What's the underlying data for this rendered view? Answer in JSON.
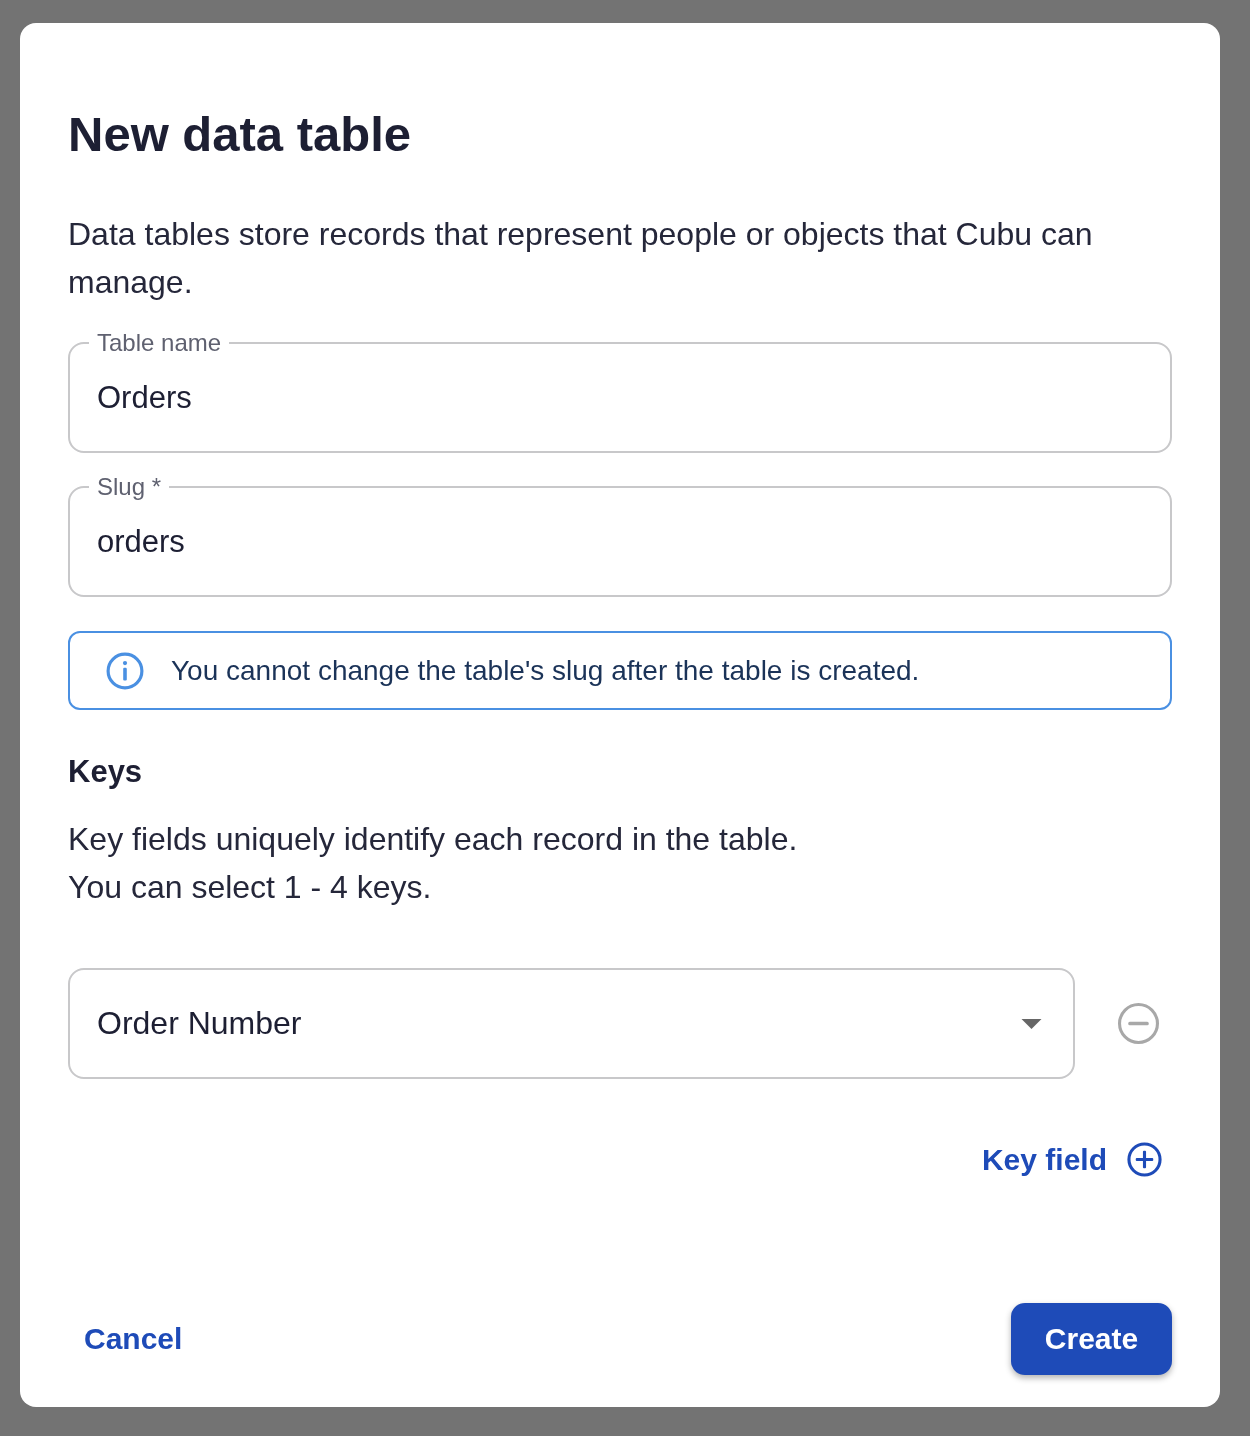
{
  "dialog": {
    "title": "New data table",
    "description": "Data tables store records that represent people or objects that Cubu can manage.",
    "fields": [
      {
        "label": "Table name",
        "value": "Orders"
      },
      {
        "label": "Slug *",
        "value": "orders"
      }
    ],
    "info": {
      "text": "You cannot change the table's slug after the table is created."
    },
    "keys": {
      "heading": "Keys",
      "description": [
        "Key fields uniquely identify each record in the table.",
        "You can select 1 - 4 keys."
      ],
      "selects": [
        {
          "value": "Order Number"
        }
      ],
      "add_button": "Key field"
    },
    "buttons": [
      {
        "label": "Cancel",
        "kind": "text"
      },
      {
        "label": "Create",
        "kind": "primary"
      }
    ]
  }
}
